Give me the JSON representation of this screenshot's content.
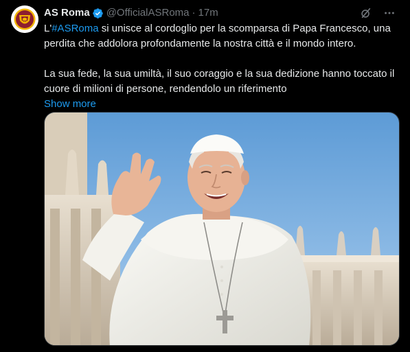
{
  "tweet": {
    "author": {
      "display_name": "AS Roma",
      "handle": "@OfficialASRoma",
      "verified": true,
      "avatar_icon": "as-roma-crest-icon"
    },
    "separator": "·",
    "timestamp": "17m",
    "header_icons": [
      "grok-icon",
      "more-options-icon"
    ],
    "text": {
      "line1_prefix": "L'",
      "hashtag": "#ASRoma",
      "line1_rest": " si unisce al cordoglio per la scomparsa di Papa Francesco, una perdita che addolora profondamente la nostra città e il mondo intero.",
      "paragraph2": "La sua fede, la sua umiltà, il suo coraggio e la sua dedizione hanno toccato il cuore di milioni di persone, rendendolo un riferimento",
      "show_more": "Show more"
    },
    "media": {
      "type": "photo"
    }
  },
  "colors": {
    "background": "#000000",
    "text": "#e7e9ea",
    "secondary": "#71767b",
    "accent": "#1d9bf0",
    "border": "#2f3336"
  }
}
